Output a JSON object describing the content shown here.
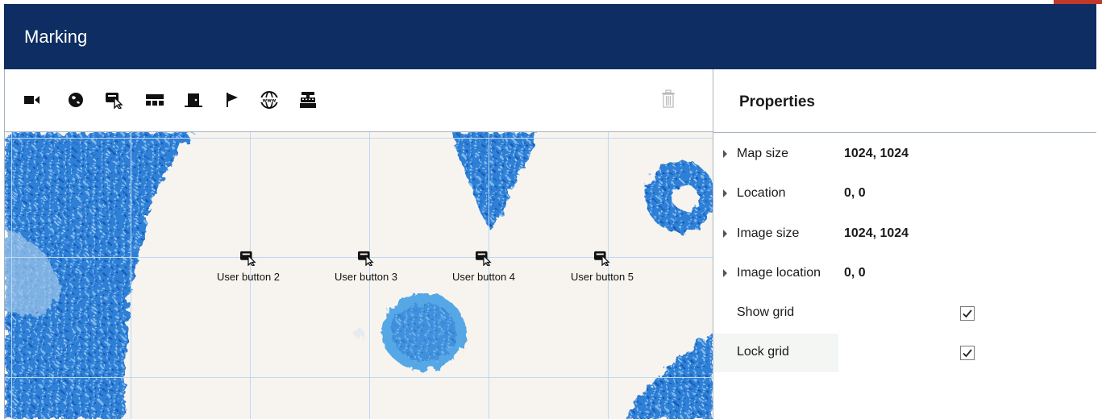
{
  "window": {
    "title": "Marking"
  },
  "toolbar": {
    "tools": [
      {
        "name": "video-camera-icon"
      },
      {
        "name": "globe-icon"
      },
      {
        "name": "user-button-icon"
      },
      {
        "name": "keyboard-icon"
      },
      {
        "name": "door-icon"
      },
      {
        "name": "flag-icon"
      },
      {
        "name": "www-icon"
      },
      {
        "name": "cash-register-icon"
      }
    ],
    "delete": {
      "name": "trash-icon",
      "enabled": false
    }
  },
  "canvas": {
    "markers": [
      {
        "label": "User button 2",
        "icon": "user-button-icon"
      },
      {
        "label": "User button 3",
        "icon": "user-button-icon"
      },
      {
        "label": "User button 4",
        "icon": "user-button-icon"
      },
      {
        "label": "User button 5",
        "icon": "user-button-icon"
      }
    ]
  },
  "properties": {
    "title": "Properties",
    "rows": [
      {
        "label": "Map size",
        "value": "1024, 1024",
        "expandable": true
      },
      {
        "label": "Location",
        "value": "0, 0",
        "expandable": true
      },
      {
        "label": "Image size",
        "value": "1024, 1024",
        "expandable": true
      },
      {
        "label": "Image location",
        "value": "0, 0",
        "expandable": true
      },
      {
        "label": "Show grid",
        "checked": true
      },
      {
        "label": "Lock grid",
        "checked": true
      }
    ]
  },
  "colors": {
    "titlebar": "#0e2d62",
    "map_blue": "#1f6fd0",
    "grid_line": "#bcd9f2"
  }
}
